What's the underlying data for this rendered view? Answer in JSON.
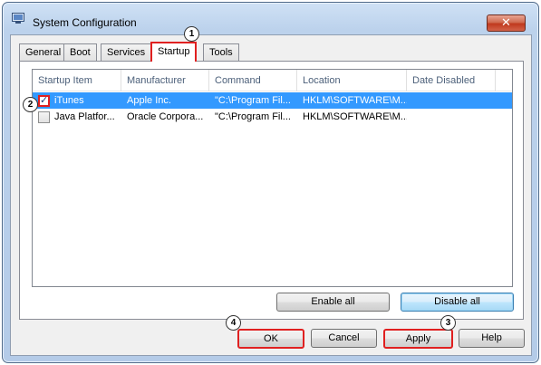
{
  "window": {
    "title": "System Configuration",
    "close_label": "✕"
  },
  "tabs": [
    {
      "label": "General"
    },
    {
      "label": "Boot"
    },
    {
      "label": "Services"
    },
    {
      "label": "Startup"
    },
    {
      "label": "Tools"
    }
  ],
  "active_tab": "Startup",
  "list": {
    "columns": [
      "Startup Item",
      "Manufacturer",
      "Command",
      "Location",
      "Date Disabled"
    ],
    "rows": [
      {
        "checked": true,
        "selected": true,
        "item": "iTunes",
        "manufacturer": "Apple Inc.",
        "command": "\"C:\\Program Fil...",
        "location": "HKLM\\SOFTWARE\\M...",
        "date_disabled": ""
      },
      {
        "checked": false,
        "selected": false,
        "item": "Java Platfor...",
        "manufacturer": "Oracle Corpora...",
        "command": "\"C:\\Program Fil...",
        "location": "HKLM\\SOFTWARE\\M...",
        "date_disabled": ""
      }
    ]
  },
  "buttons": {
    "enable_all": "Enable all",
    "disable_all": "Disable all",
    "ok": "OK",
    "cancel": "Cancel",
    "apply": "Apply",
    "help": "Help"
  },
  "callouts": {
    "one": "1",
    "two": "2",
    "three": "3",
    "four": "4"
  },
  "colors": {
    "highlight": "#e02020",
    "selection": "#3399ff"
  },
  "icons": {
    "app": "system-configuration-icon",
    "close": "close-icon",
    "checkmark": "✓"
  }
}
